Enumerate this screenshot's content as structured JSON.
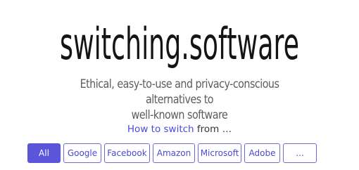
{
  "logo": {
    "text": "switching.software"
  },
  "tagline": {
    "line1": "Ethical, easy-to-use and privacy-conscious alternatives to",
    "line2": "well-known software"
  },
  "how_to": {
    "link_text": "How to switch",
    "suffix": " from …"
  },
  "filters": {
    "items": [
      {
        "label": "All",
        "active": true
      },
      {
        "label": "Google",
        "active": false
      },
      {
        "label": "Facebook",
        "active": false
      },
      {
        "label": "Amazon",
        "active": false
      },
      {
        "label": "Microsoft",
        "active": false
      },
      {
        "label": "Adobe",
        "active": false
      },
      {
        "label": "...",
        "active": false
      }
    ]
  },
  "colors": {
    "accent": "#5a55d9",
    "link": "#4a4adf",
    "logo": "#141414",
    "tagline": "#5c5c5c"
  }
}
